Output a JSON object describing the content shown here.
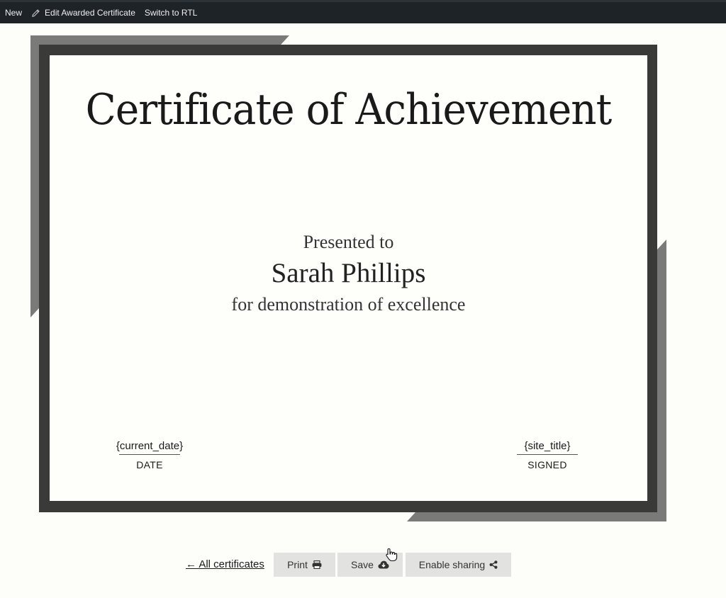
{
  "adminbar": {
    "new_label": "New",
    "edit_label": "Edit Awarded Certificate",
    "rtl_label": "Switch to RTL",
    "edit_icon": "pencil-icon"
  },
  "certificate": {
    "title": "Certificate of Achievement",
    "presented_to": "Presented to",
    "recipient": "Sarah Phillips",
    "reason": "for demonstration of excellence",
    "date_value": "{current_date}",
    "date_label": "DATE",
    "signed_value": "{site_title}",
    "signed_label": "SIGNED",
    "frame_color": "#3a3b38",
    "accent_color": "#757573"
  },
  "actions": {
    "back_label": "← All certificates",
    "print_label": "Print",
    "print_icon": "printer-icon",
    "save_label": "Save",
    "save_icon": "cloud-download-icon",
    "share_label": "Enable sharing",
    "share_icon": "share-icon"
  }
}
